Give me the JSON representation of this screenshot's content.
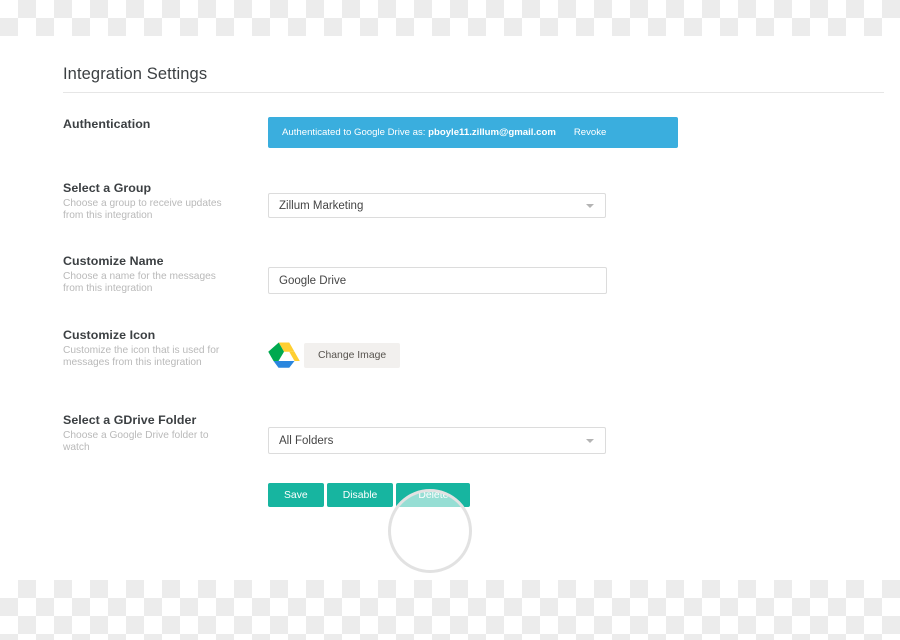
{
  "page": {
    "title": "Integration Settings"
  },
  "sections": {
    "authentication": {
      "label": "Authentication",
      "banner_prefix": "Authenticated to Google Drive as:",
      "email": "pboyle11.zillum@gmail.com",
      "revoke_label": "Revoke",
      "banner_color": "#3aaede"
    },
    "group": {
      "label": "Select a Group",
      "description": "Choose a group to receive updates from this integration",
      "selected": "Zillum Marketing"
    },
    "name": {
      "label": "Customize Name",
      "description": "Choose a name for the messages from this integration",
      "value": "Google Drive"
    },
    "icon": {
      "label": "Customize Icon",
      "description": "Customize the icon that is used for messages from this integration",
      "icon_name": "google-drive-icon",
      "change_button": "Change Image"
    },
    "folder": {
      "label": "Select a GDrive Folder",
      "description": "Choose a Google Drive folder to watch",
      "selected": "All Folders"
    }
  },
  "actions": {
    "save": "Save",
    "disable": "Disable",
    "delete": "Delete",
    "button_color": "#17b5a0"
  }
}
